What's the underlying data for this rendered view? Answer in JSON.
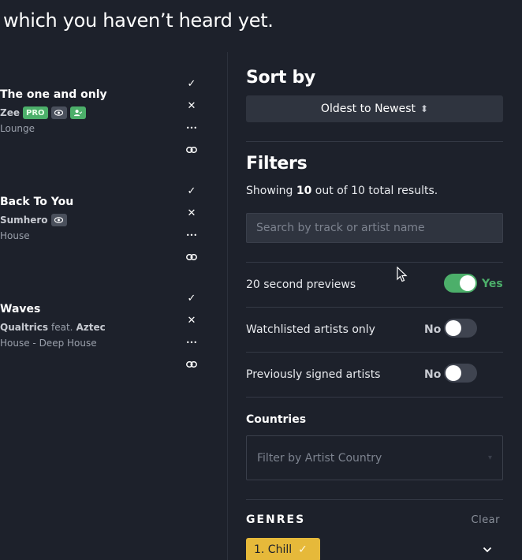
{
  "headline": "which you haven’t heard yet.",
  "tracks": [
    {
      "title": "The one and only",
      "artist": "Zee",
      "feat": "",
      "feat_artist": "",
      "badges": [
        "PRO",
        "eye",
        "user"
      ],
      "genre": "Lounge"
    },
    {
      "title": "Back To You",
      "artist": "Sumhero",
      "feat": "",
      "feat_artist": "",
      "badges": [
        "eye"
      ],
      "genre": "House"
    },
    {
      "title": "Waves",
      "artist": "Qualtrics",
      "feat": "feat.",
      "feat_artist": "Aztec",
      "badges": [],
      "genre": "House - Deep House"
    }
  ],
  "track_actions": {
    "accept_icon": "✓",
    "reject_icon": "✕",
    "more_icon": "•••",
    "link_icon": "link-icon"
  },
  "sort": {
    "heading": "Sort by",
    "selected": "Oldest to Newest",
    "icon": "⬍"
  },
  "filters": {
    "heading": "Filters",
    "showing_prefix": "Showing ",
    "showing_count": "10",
    "showing_suffix": " out of 10 total results.",
    "search_placeholder": "Search by track or artist name",
    "options": [
      {
        "label": "20 second previews",
        "state": "Yes",
        "on": true
      },
      {
        "label": "Watchlisted artists only",
        "state": "No",
        "on": false
      },
      {
        "label": "Previously signed artists",
        "state": "No",
        "on": false
      }
    ],
    "countries_label": "Countries",
    "countries_placeholder": "Filter by Artist Country",
    "genres_label": "GENRES",
    "genres_clear": "Clear",
    "genre_chip": "1. Chill",
    "genre_chip_check": "✓"
  },
  "colors": {
    "background": "#1d212b",
    "accent_green": "#4caf6a",
    "chip_yellow": "#e6b93a",
    "control_bg": "#2f343f"
  }
}
